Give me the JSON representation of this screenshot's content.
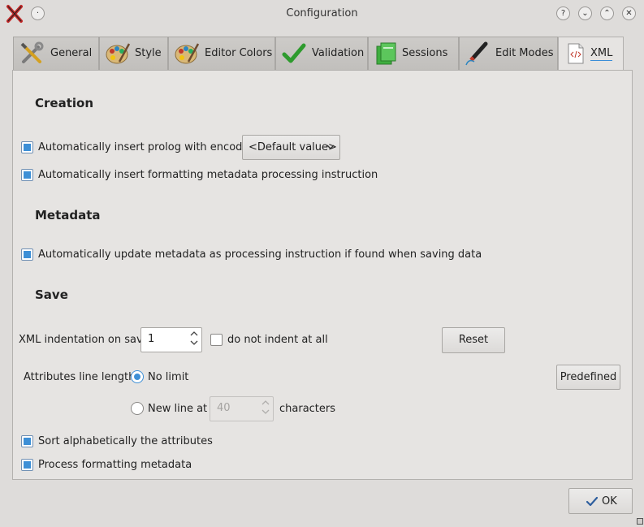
{
  "window": {
    "title": "Configuration",
    "buttons": {
      "help": "?",
      "minimize": "⌄",
      "maximize": "⌃",
      "close": "✕"
    }
  },
  "tabs": [
    {
      "label": "General",
      "icon": "tools-icon"
    },
    {
      "label": "Style",
      "icon": "palette-icon"
    },
    {
      "label": "Editor Colors",
      "icon": "palette-icon"
    },
    {
      "label": "Validation",
      "icon": "checkmark-icon"
    },
    {
      "label": "Sessions",
      "icon": "sessions-icon"
    },
    {
      "label": "Edit Modes",
      "icon": "pen-icon"
    },
    {
      "label": "XML",
      "icon": "xml-file-icon",
      "active": true
    }
  ],
  "creation": {
    "heading": "Creation",
    "prolog_label": "Automatically insert prolog with encoding:",
    "prolog_checked": true,
    "encoding_value": "<Default value>",
    "formatting_pi_label": "Automatically insert formatting metadata processing instruction",
    "formatting_pi_checked": true
  },
  "metadata": {
    "heading": "Metadata",
    "update_label": "Automatically update metadata as processing instruction if found when saving data",
    "update_checked": true
  },
  "save": {
    "heading": "Save",
    "indent_label": "XML indentation on save",
    "indent_value": "1",
    "no_indent_label": "do not indent at all",
    "no_indent_checked": false,
    "reset_label": "Reset",
    "attr_line_label": "Attributes line length:",
    "no_limit_label": "No limit",
    "no_limit_selected": true,
    "predefined_label": "Predefined",
    "new_line_label": "New line at",
    "new_line_value": "40",
    "characters_label": "characters",
    "sort_label": "Sort alphabetically the attributes",
    "sort_checked": true,
    "process_label": "Process formatting metadata",
    "process_checked": true
  },
  "footer": {
    "ok_label": "OK"
  },
  "colors": {
    "accent": "#3d8fd6",
    "background": "#dedcda",
    "panel": "#e6e4e2"
  }
}
